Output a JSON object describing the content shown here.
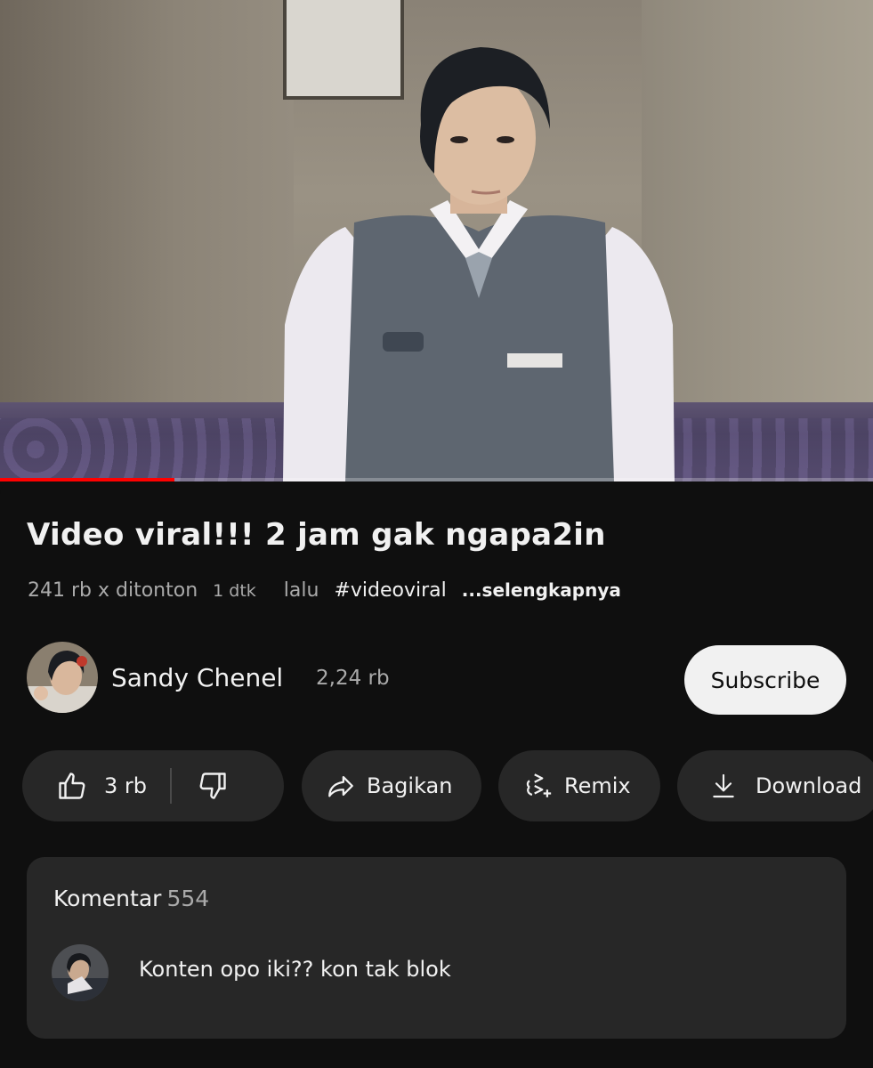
{
  "video": {
    "progress_fraction": 0.2,
    "title": "Video viral!!! 2 jam gak ngapa2in",
    "views": "241 rb x ditonton",
    "time": "1 dtk",
    "time_suffix": "lalu",
    "hashtag": "#videoviral",
    "more": "...selengkapnya"
  },
  "channel": {
    "name": "Sandy Chenel",
    "subscribers": "2,24 rb",
    "subscribe_label": "Subscribe"
  },
  "actions": {
    "like_count": "3 rb",
    "share_label": "Bagikan",
    "remix_label": "Remix",
    "download_label": "Download"
  },
  "comments": {
    "header": "Komentar",
    "count": "554",
    "top_comment": "Konten opo iki?? kon tak blok"
  },
  "colors": {
    "background": "#0f0f0f",
    "surface": "#272727",
    "progress": "#ff0000",
    "text_primary": "#f1f1f1",
    "text_secondary": "#aaaaaa"
  },
  "icons": {
    "like": "thumbs-up-icon",
    "dislike": "thumbs-down-icon",
    "share": "share-arrow-icon",
    "remix": "remix-icon",
    "download": "download-icon"
  }
}
